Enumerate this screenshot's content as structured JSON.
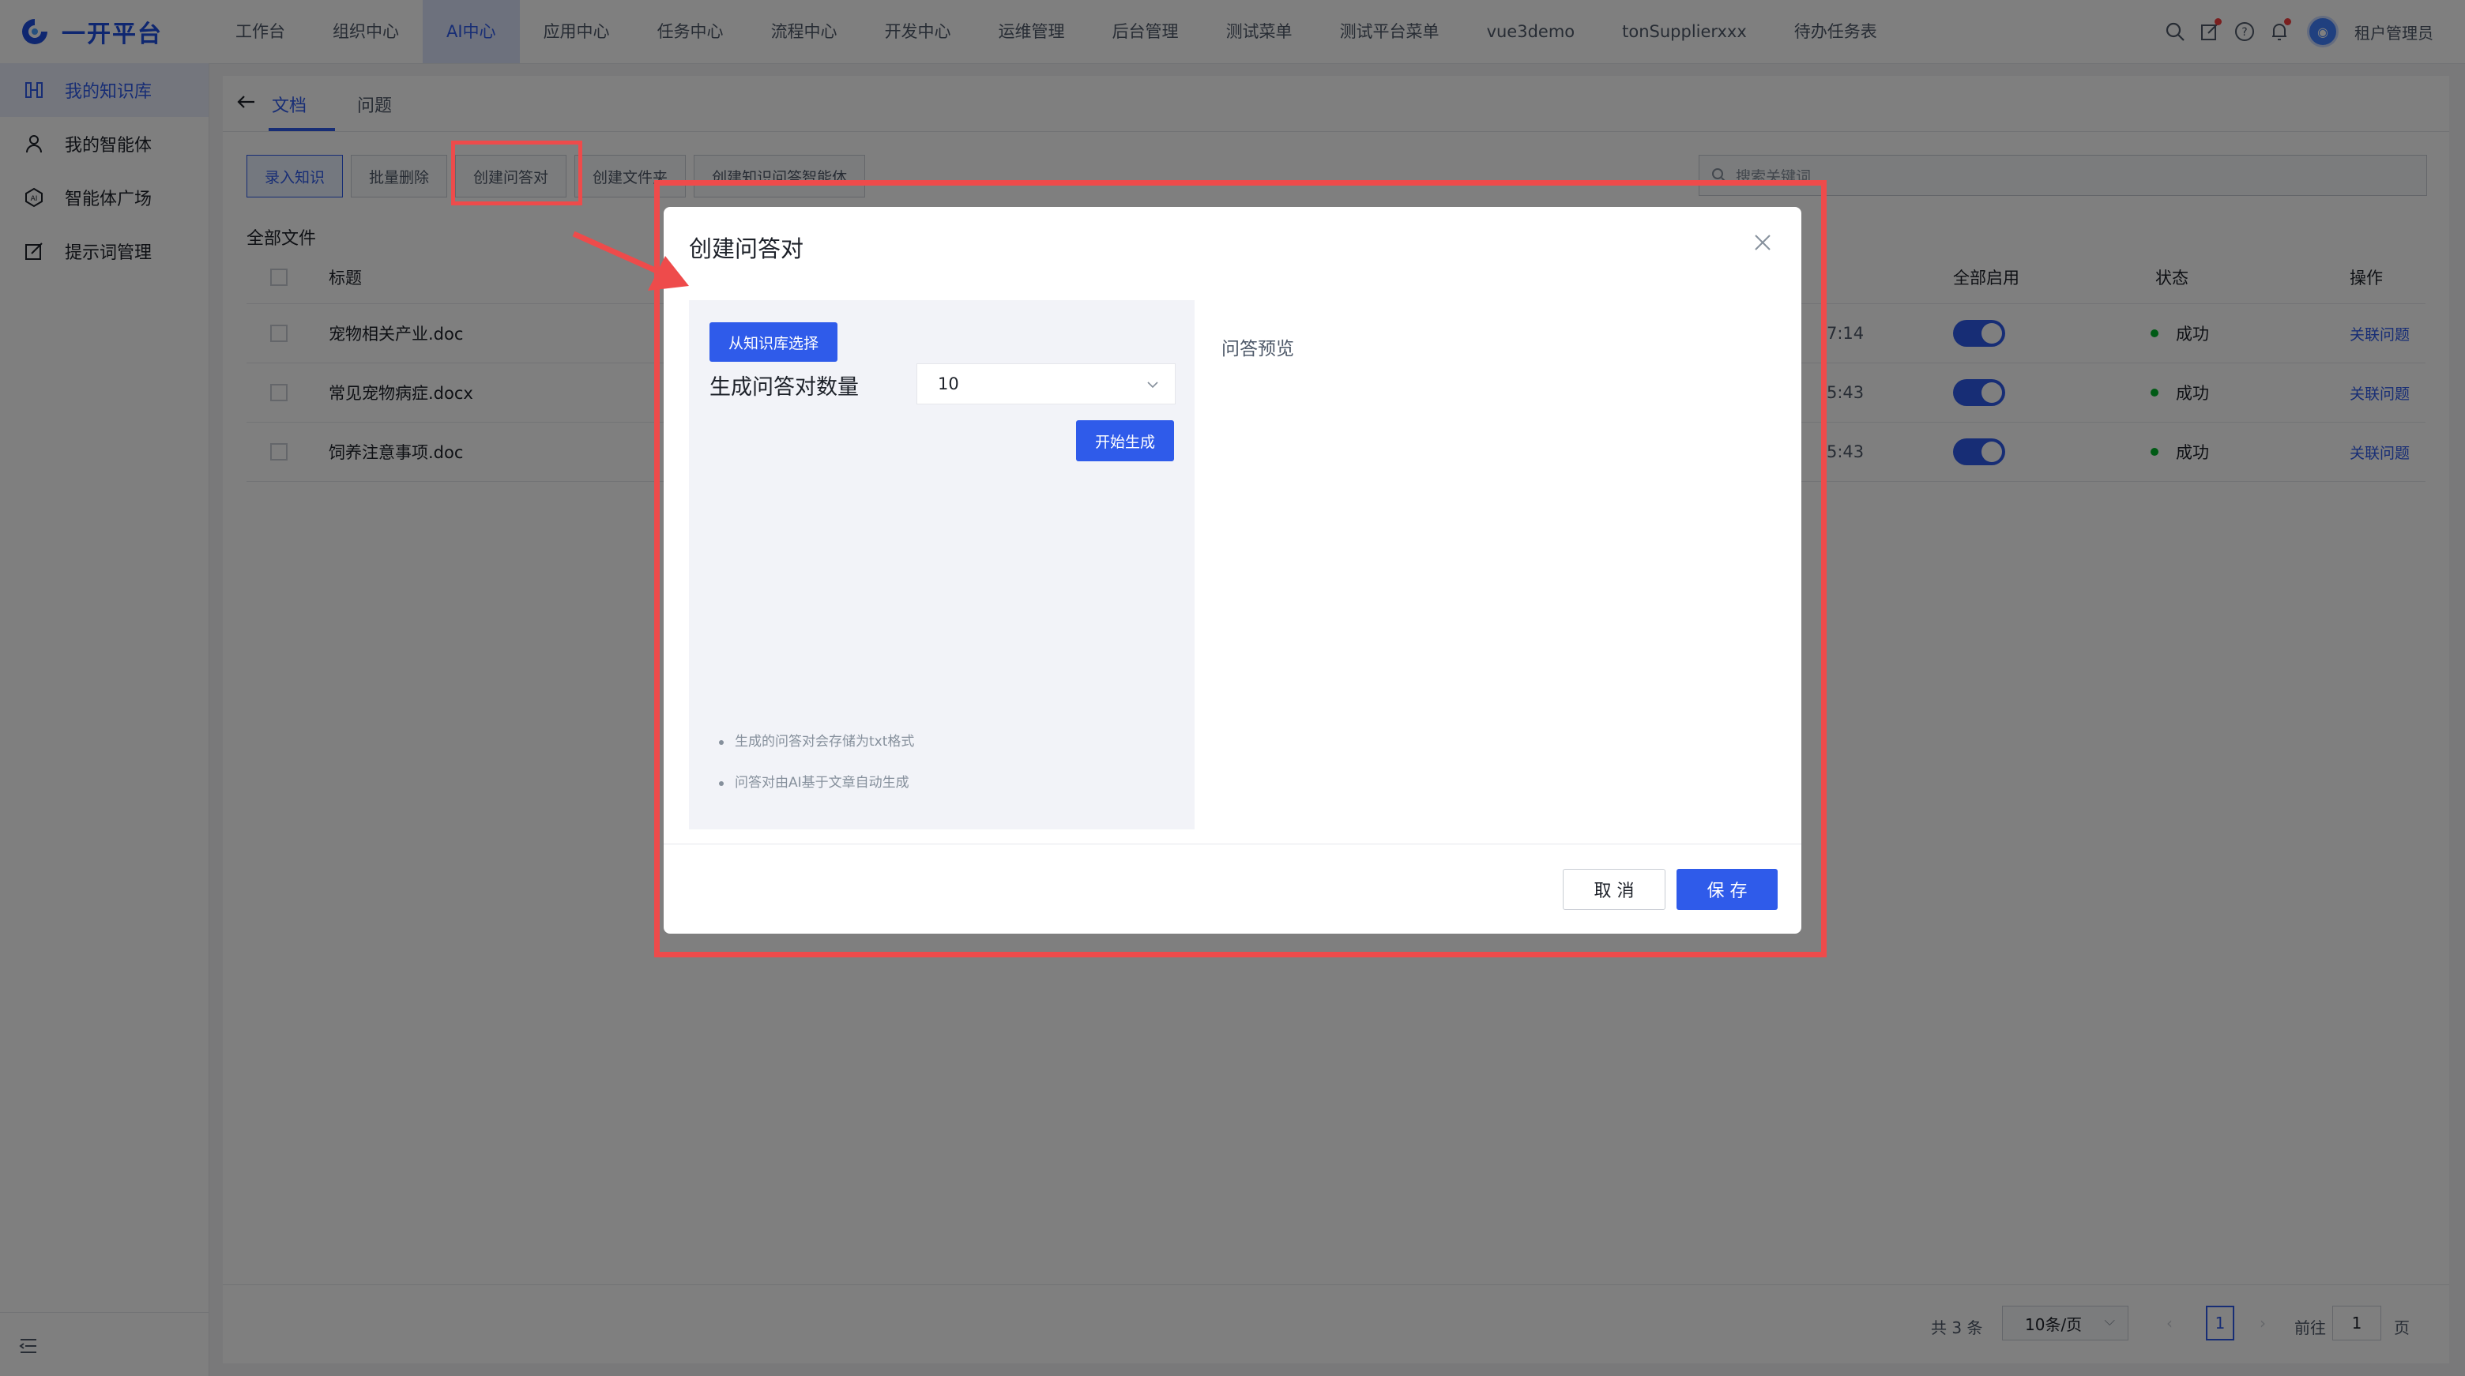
{
  "brand": {
    "name": "一开平台",
    "accent": "#2f5bea",
    "highlight": "#ee4b4b"
  },
  "topnav": {
    "items": [
      "工作台",
      "组织中心",
      "AI中心",
      "应用中心",
      "任务中心",
      "流程中心",
      "开发中心",
      "运维管理",
      "后台管理",
      "测试菜单",
      "测试平台菜单",
      "vue3demo",
      "tonSupplierxxx",
      "待办任务表"
    ],
    "active": "AI中心",
    "icons": [
      "search-icon",
      "edit-icon",
      "help-icon",
      "bell-icon"
    ],
    "user": "租户管理员"
  },
  "sidebar": {
    "items": [
      {
        "label": "我的知识库",
        "icon": "knowledge-icon"
      },
      {
        "label": "我的智能体",
        "icon": "user-icon"
      },
      {
        "label": "智能体广场",
        "icon": "ai-icon"
      },
      {
        "label": "提示词管理",
        "icon": "prompt-icon"
      }
    ],
    "active": "我的知识库"
  },
  "main": {
    "tabs": [
      "文档",
      "问题"
    ],
    "active_tab": "文档",
    "toolbar": [
      "录入知识",
      "批量删除",
      "创建问答对",
      "创建文件夹",
      "创建知识问答智能体"
    ],
    "search_placeholder": "搜索关键词",
    "section_title": "全部文件",
    "columns": {
      "title": "标题",
      "enable_all": "全部启用",
      "status": "状态",
      "action": "操作"
    },
    "rows": [
      {
        "title": "宠物相关产业.doc",
        "time_tail": "7:14",
        "status": "成功",
        "action": "关联问题",
        "enabled": true
      },
      {
        "title": "常见宠物病症.docx",
        "time_tail": "5:43",
        "status": "成功",
        "action": "关联问题",
        "enabled": true
      },
      {
        "title": "饲养注意事项.doc",
        "time_tail": "5:43",
        "status": "成功",
        "action": "关联问题",
        "enabled": true
      }
    ],
    "pagination": {
      "total": "共 3 条",
      "page_size": "10条/页",
      "current": "1",
      "goto_label": "前往",
      "goto_value": "1",
      "page_unit": "页"
    }
  },
  "dialog": {
    "title": "创建问答对",
    "select_button": "从知识库选择",
    "count_label": "生成问答对数量",
    "count_value": "10",
    "generate_button": "开始生成",
    "notes": [
      "生成的问答对会存储为txt格式",
      "问答对由AI基于文章自动生成"
    ],
    "preview_label": "问答预览",
    "cancel": "取 消",
    "save": "保 存"
  }
}
